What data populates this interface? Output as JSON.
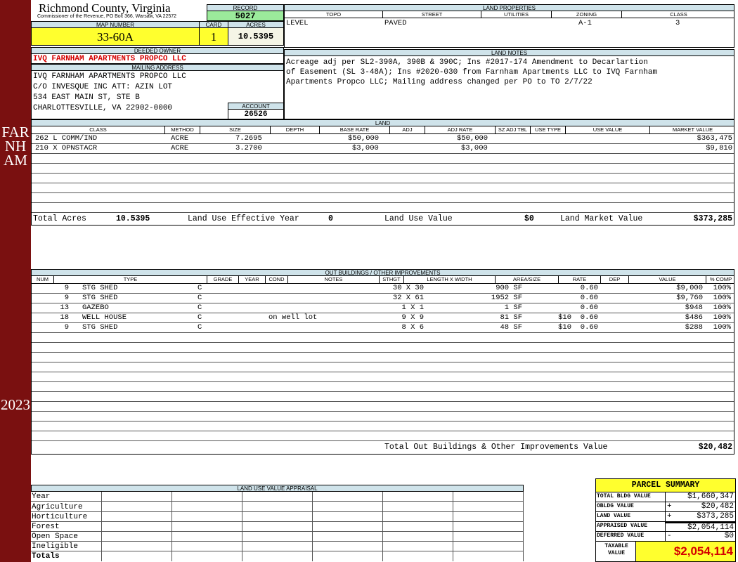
{
  "sidebar": {
    "name": "FARNHAM",
    "year": "2023"
  },
  "header": {
    "county": "Richmond County, Virginia",
    "address": "Commissioner of the Revenue, PO Box 366, Warsaw, VA 22572",
    "record_label": "RECORD",
    "record": "5027",
    "map_label": "MAP NUMBER",
    "map": "33-60A",
    "card_label": "CARD",
    "card": "1",
    "acres_label": "ACRES",
    "acres": "10.5395",
    "owner_label": "DEEDED OWNER",
    "owner": "IVQ FARNHAM APARTMENTS PROPCO LLC",
    "mail_label": "MAILING ADDRESS",
    "mail_lines": [
      "IVQ FARNHAM APARTMENTS PROPCO LLC",
      "C/O INVESQUE INC ATT: AZIN LOT",
      "534 EAST MAIN ST, STE B",
      "CHARLOTTESVILLE, VA 22902-0000"
    ],
    "account_label": "ACCOUNT",
    "account": "26526"
  },
  "land_properties": {
    "title": "LAND PROPERTIES",
    "headers": [
      "TOPO",
      "STREET",
      "UTILITIES",
      "ZONING",
      "CLASS"
    ],
    "values": [
      "LEVEL",
      "PAVED",
      "",
      "A-1",
      "3"
    ]
  },
  "land_notes": {
    "title": "LAND NOTES",
    "lines": [
      "Acreage adj per SL2-390A, 390B & 390C; Ins #2017-174 Amendment to Decarlartion",
      "of Easement (SL 3-48A); Ins #2020-030 from Farnham Apartments LLC to IVQ Farnham",
      "Apartments Propco LLC; Mailing address changed per PO to TO 2/7/22"
    ]
  },
  "land": {
    "title": "LAND",
    "headers": [
      "CLASS",
      "METHOD",
      "SIZE",
      "DEPTH",
      "BASE RATE",
      "ADJ",
      "ADJ RATE",
      "SZ ADJ TBL",
      "USE TYPE",
      "USE VALUE",
      "MARKET VALUE"
    ],
    "rows": [
      {
        "class": "262 L COMM/IND",
        "method": "ACRE",
        "size": "7.2695",
        "base_rate": "$50,000",
        "adj_rate": "$50,000",
        "market": "$363,475"
      },
      {
        "class": "210 X OPNSTACR",
        "method": "ACRE",
        "size": "3.2700",
        "base_rate": "$3,000",
        "adj_rate": "$3,000",
        "market": "$9,810"
      }
    ],
    "total_acres_label": "Total Acres",
    "total_acres": "10.5395",
    "eff_year_label": "Land Use Effective Year",
    "eff_year": "0",
    "use_value_label": "Land Use Value",
    "use_value": "$0",
    "market_label": "Land Market Value",
    "market": "$373,285"
  },
  "outbuildings": {
    "title": "OUT BUILDINGS / OTHER IMPROVEMENTS",
    "headers": [
      "NUM",
      "TYPE",
      "GRADE",
      "YEAR",
      "COND",
      "NOTES",
      "STHGT",
      "LENGTH X WIDTH",
      "AREA/SIZE",
      "RATE",
      "DEP",
      "VALUE",
      "% COMP"
    ],
    "rows": [
      {
        "num": "9",
        "type": "STG SHED",
        "grade": "C",
        "notes": "",
        "lw": "30 X 30",
        "area": "900 SF",
        "rate": "",
        "dep": "0.60",
        "value": "$9,000",
        "comp": "100%"
      },
      {
        "num": "9",
        "type": "STG SHED",
        "grade": "C",
        "notes": "",
        "lw": "32 X 61",
        "area": "1952 SF",
        "rate": "",
        "dep": "0.60",
        "value": "$9,760",
        "comp": "100%"
      },
      {
        "num": "13",
        "type": "GAZEBO",
        "grade": "C",
        "notes": "",
        "lw": "1 X 1",
        "area": "1 SF",
        "rate": "",
        "dep": "0.60",
        "value": "$948",
        "comp": "100%"
      },
      {
        "num": "18",
        "type": "WELL HOUSE",
        "grade": "C",
        "notes": "on well lot",
        "lw": "9 X 9",
        "area": "81 SF",
        "rate": "$10",
        "dep": "0.60",
        "value": "$486",
        "comp": "100%"
      },
      {
        "num": "9",
        "type": "STG SHED",
        "grade": "C",
        "notes": "",
        "lw": "8 X 6",
        "area": "48 SF",
        "rate": "$10",
        "dep": "0.60",
        "value": "$288",
        "comp": "100%"
      }
    ],
    "total_label": "Total Out Buildings & Other Improvements Value",
    "total": "$20,482"
  },
  "land_use": {
    "title": "LAND USE VALUE APPRAISAL",
    "rows": [
      "Year",
      "Agriculture",
      "Horticulture",
      "Forest",
      "Open Space",
      "Ineligible",
      "Totals"
    ]
  },
  "summary": {
    "title": "PARCEL SUMMARY",
    "rows": [
      {
        "label": "TOTAL BLDG VALUE",
        "op": "",
        "value": "$1,660,347"
      },
      {
        "label": "OBLDG VALUE",
        "op": "+",
        "value": "$20,482"
      },
      {
        "label": "LAND VALUE",
        "op": "+",
        "value": "$373,285"
      },
      {
        "label": "APPRAISED VALUE",
        "op": "",
        "value": "$2,054,114"
      },
      {
        "label": "DEFERRED VALUE",
        "op": "-",
        "value": "$0"
      }
    ],
    "taxable_label": "TAXABLE VALUE",
    "taxable": "$2,054,114"
  }
}
